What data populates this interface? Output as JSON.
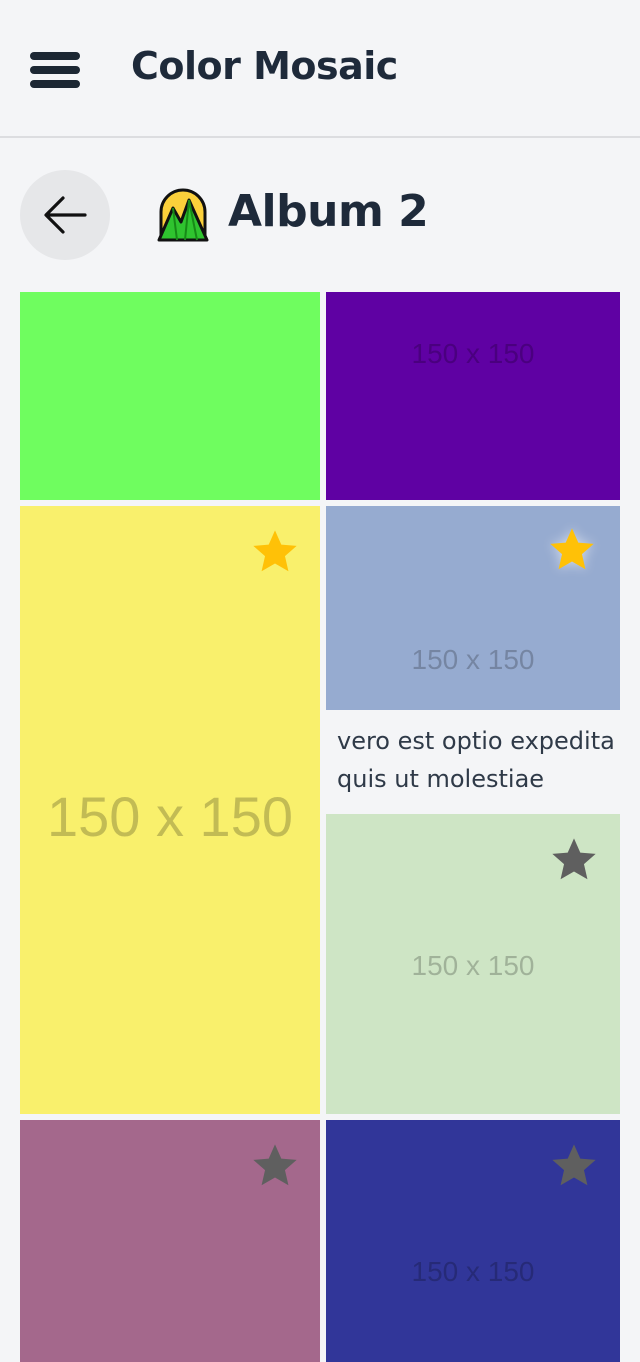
{
  "header": {
    "title": "Color Mosaic",
    "menu_icon": "hamburger-menu-icon"
  },
  "album": {
    "title": "Album 2",
    "icon": "mountain-sunrise-emoji",
    "back_icon": "arrow-left-icon"
  },
  "placeholder_text": "150 x 150",
  "photos": [
    {
      "color": "#6ffd5f",
      "placeholder": "",
      "starred": null
    },
    {
      "color": "#5f01a3",
      "placeholder": "150 x 150",
      "starred": null
    },
    {
      "color": "#f9f06c",
      "placeholder": "150 x 150",
      "starred": true
    },
    {
      "color": "#96abd0",
      "placeholder": "150 x 150",
      "starred": true,
      "caption_line1": "vero est optio expedita",
      "caption_line2": "quis ut molestiae"
    },
    {
      "color": "#cee5c5",
      "placeholder": "150 x 150",
      "starred": false
    },
    {
      "color": "#a4688c",
      "placeholder": "",
      "starred": false
    },
    {
      "color": "#313699",
      "placeholder": "150 x 150",
      "starred": false
    }
  ],
  "star_colors": {
    "active": "#ffc107",
    "inactive": "#5f5f5f"
  }
}
